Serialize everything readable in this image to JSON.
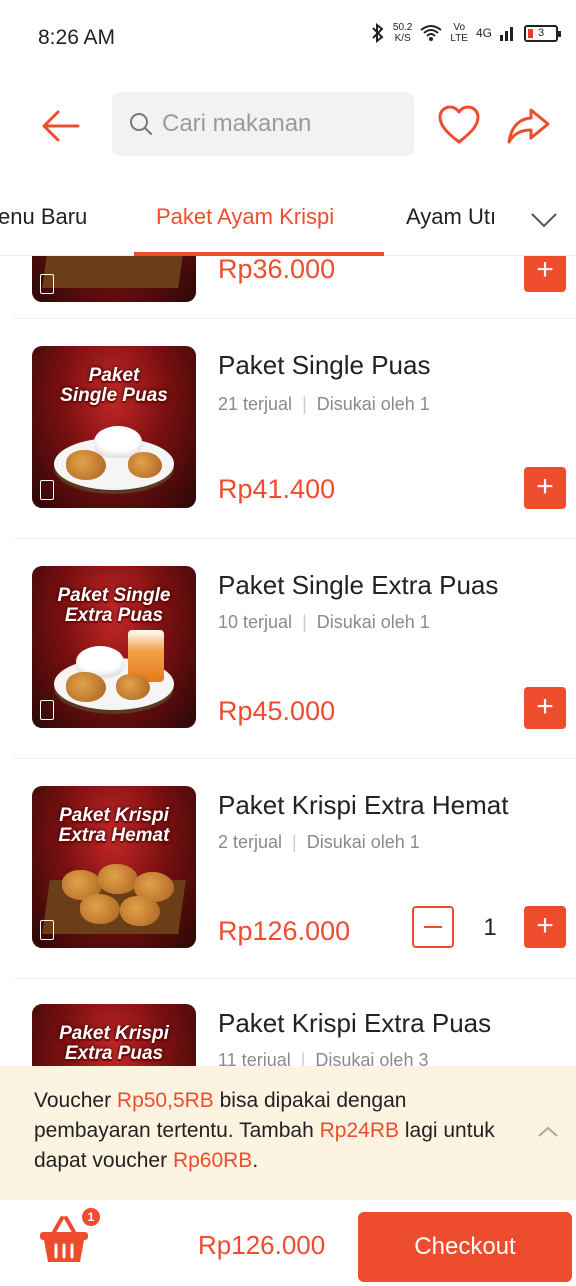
{
  "status_bar": {
    "time": "8:26 AM",
    "speed_value": "50.2",
    "speed_unit": "K/S",
    "volte_top": "Vo",
    "volte_bottom": "LTE",
    "network": "4G",
    "battery": "3"
  },
  "header": {
    "search_placeholder": "Cari makanan"
  },
  "tabs": [
    {
      "label": "enu Baru",
      "active": false
    },
    {
      "label": "Paket Ayam Krispi",
      "active": true
    },
    {
      "label": "Ayam Utı",
      "active": false
    }
  ],
  "items": [
    {
      "name": "",
      "sold": "",
      "likes": "",
      "price": "Rp36.000",
      "image_text": ""
    },
    {
      "name": "Paket Single Puas",
      "sold": "21 terjual",
      "likes": "Disukai oleh 1",
      "price": "Rp41.400",
      "image_text_1": "Paket",
      "image_text_2": "Single Puas"
    },
    {
      "name": "Paket Single Extra Puas",
      "sold": "10 terjual",
      "likes": "Disukai oleh 1",
      "price": "Rp45.000",
      "image_text_1": "Paket Single",
      "image_text_2": "Extra Puas"
    },
    {
      "name": "Paket Krispi Extra Hemat",
      "sold": "2 terjual",
      "likes": "Disukai oleh 1",
      "price": "Rp126.000",
      "quantity": "1",
      "image_text_1": "Paket Krispi",
      "image_text_2": "Extra Hemat"
    },
    {
      "name": "Paket Krispi Extra Puas",
      "sold": "11 terjual",
      "likes": "Disukai oleh 3",
      "image_text_1": "Paket Krispi",
      "image_text_2": "Extra Puas"
    }
  ],
  "voucher": {
    "t1": "Voucher ",
    "v1": "Rp50,5RB",
    "t2": " bisa dipakai dengan pembayaran tertentu. Tambah ",
    "v2": "Rp24RB",
    "t3": " lagi untuk dapat voucher ",
    "v3": "Rp60RB",
    "t4": "."
  },
  "bottom": {
    "cart_count": "1",
    "total": "Rp126.000",
    "checkout_label": "Checkout"
  },
  "colors": {
    "accent": "#ee4d2d",
    "voucher_bg": "#fdf3e1"
  },
  "icons": {
    "back": "arrow-left-icon",
    "search": "search-icon",
    "favorite": "heart-icon",
    "share": "share-icon",
    "tabs_more": "chevron-down-icon",
    "voucher_toggle": "chevron-up-icon",
    "cart": "basket-icon"
  }
}
